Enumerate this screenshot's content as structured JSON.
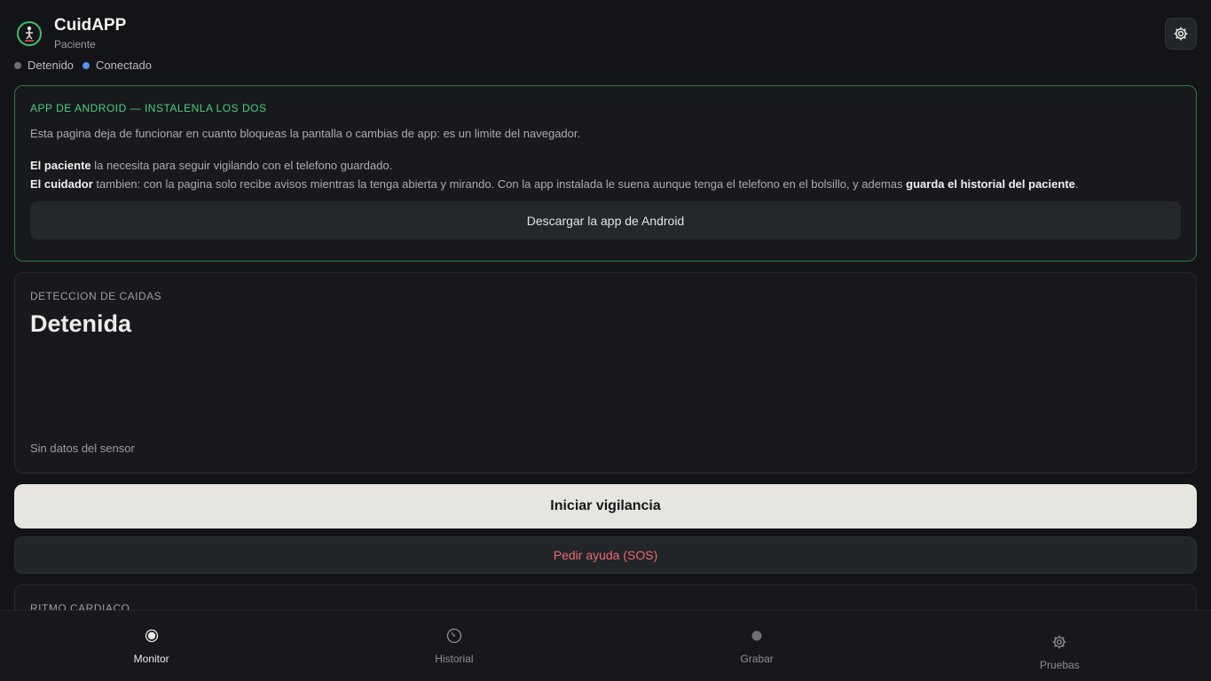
{
  "header": {
    "app_title": "CuidAPP",
    "app_subtitle": "Paciente",
    "status": [
      {
        "label": "Detenido",
        "color": "#6d7076"
      },
      {
        "label": "Conectado",
        "color": "#5b8ff0"
      }
    ],
    "settings_icon": "gear-icon"
  },
  "notice": {
    "title": "APP DE ANDROID — INSTALENLA LOS DOS",
    "intro": "Esta pagina deja de funcionar en cuanto bloqueas la pantalla o cambias de app: es un limite del navegador.",
    "patient_bold": "El paciente",
    "patient_text": " la necesita para seguir vigilando con el telefono guardado.",
    "caregiver_bold": "El cuidador",
    "caregiver_text": " tambien: con la pagina solo recibe avisos mientras la tenga abierta y mirando. Con la app instalada le suena aunque tenga el telefono en el bolsillo, y ademas ",
    "caregiver_bold2": "guarda el historial del paciente",
    "caregiver_end": ".",
    "download_label": "Descargar la app de Android",
    "accent_color": "#4bd07a"
  },
  "fall_detection": {
    "label": "DETECCION DE CAIDAS",
    "status": "Detenida",
    "sensor_text": "Sin datos del sensor"
  },
  "actions": {
    "start_label": "Iniciar vigilancia",
    "sos_label": "Pedir ayuda (SOS)",
    "sos_color": "#ec6a6a"
  },
  "heart_rate": {
    "label": "RITMO CARDIACO"
  },
  "nav": {
    "items": [
      {
        "label": "Monitor",
        "icon": "monitor-icon",
        "active": true
      },
      {
        "label": "Historial",
        "icon": "clock-icon",
        "active": false
      },
      {
        "label": "Grabar",
        "icon": "record-icon",
        "active": false
      },
      {
        "label": "Pruebas",
        "icon": "gear-icon",
        "active": false
      }
    ]
  }
}
